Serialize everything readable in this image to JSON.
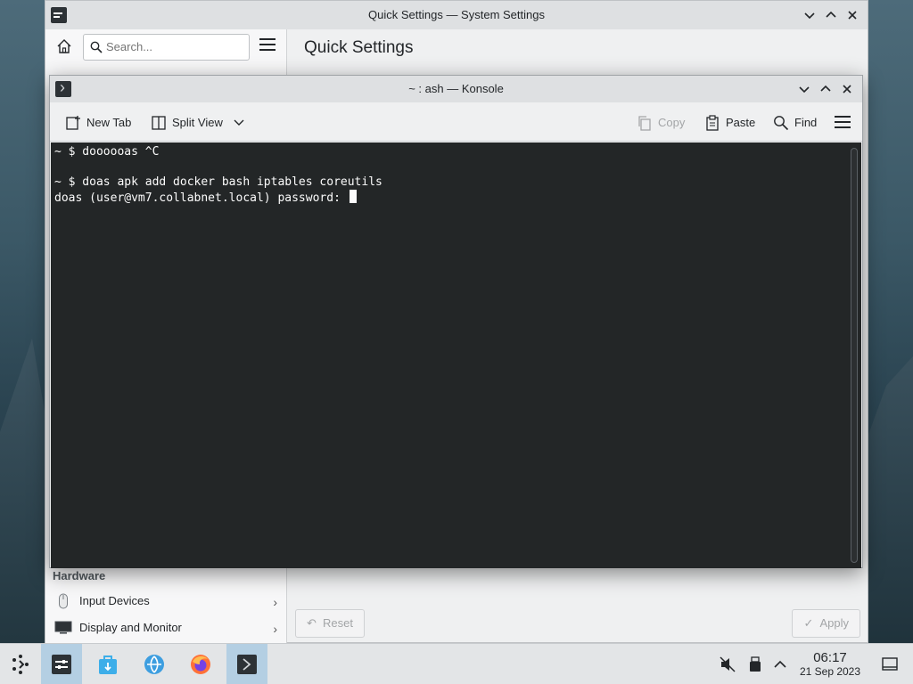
{
  "system_settings": {
    "title": "Quick Settings — System Settings",
    "search_placeholder": "Search...",
    "page_title": "Quick Settings",
    "hardware_header": "Hardware",
    "items": [
      {
        "label": "Input Devices",
        "icon": "mouse-icon"
      },
      {
        "label": "Display and Monitor",
        "icon": "monitor-icon"
      }
    ],
    "reset_label": "Reset",
    "apply_label": "Apply"
  },
  "konsole": {
    "title": "~ : ash — Konsole",
    "toolbar": {
      "new_tab": "New Tab",
      "split_view": "Split View",
      "copy": "Copy",
      "paste": "Paste",
      "find": "Find"
    },
    "terminal_lines": [
      "~ $ doooooas ^C",
      "",
      "~ $ doas apk add docker bash iptables coreutils",
      "doas (user@vm7.collabnet.local) password: "
    ]
  },
  "taskbar": {
    "time": "06:17",
    "date": "21 Sep 2023",
    "launchers": [
      "application-launcher-icon",
      "system-settings-icon",
      "discover-icon",
      "network-icon",
      "firefox-icon",
      "konsole-icon"
    ],
    "tray": [
      "volume-muted-icon",
      "usb-device-icon",
      "tray-expand-icon",
      "show-desktop-icon"
    ]
  },
  "colors": {
    "terminal_bg": "#232627",
    "terminal_fg": "#fcfcfc",
    "active_task": "#b4cfe3",
    "titlebar": "#dee0e2"
  }
}
